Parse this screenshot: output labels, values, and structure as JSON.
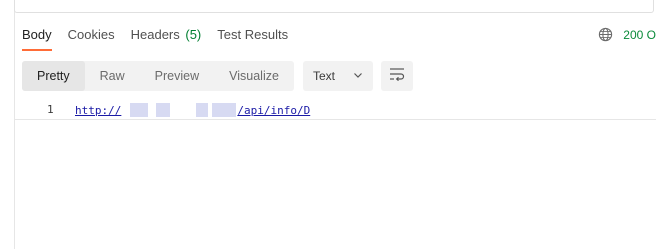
{
  "tabs": [
    {
      "label": "Body",
      "active": true
    },
    {
      "label": "Cookies",
      "active": false
    },
    {
      "label": "Headers",
      "count": "(5)",
      "active": false
    },
    {
      "label": "Test Results",
      "active": false
    }
  ],
  "status": {
    "text": "200 O",
    "color": "#0a8a3a",
    "icon": "globe-icon"
  },
  "view_modes": [
    {
      "label": "Pretty",
      "active": true
    },
    {
      "label": "Raw",
      "active": false
    },
    {
      "label": "Preview",
      "active": false
    },
    {
      "label": "Visualize",
      "active": false
    }
  ],
  "format_dropdown": {
    "value": "Text",
    "icon": "chevron-down-icon"
  },
  "wrap_button": {
    "icon": "wrap-lines-icon"
  },
  "editor": {
    "line_number": "1",
    "url_prefix": "http://",
    "url_suffix": "/api/info/D"
  },
  "colors": {
    "active_tab_underline": "#ff6c37",
    "count_green": "#007f31",
    "link_blue": "#1a1aa6"
  }
}
